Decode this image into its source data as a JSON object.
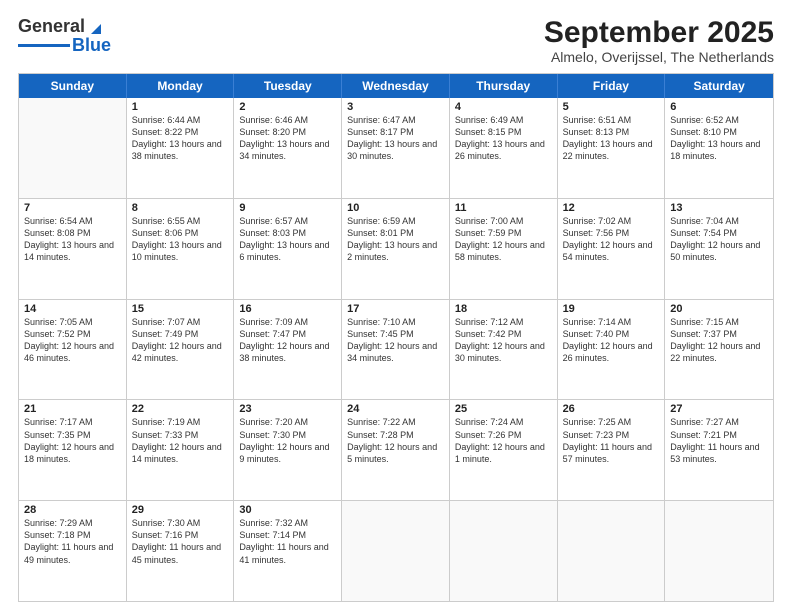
{
  "logo": {
    "line1": "General",
    "line2": "Blue"
  },
  "title": "September 2025",
  "location": "Almelo, Overijssel, The Netherlands",
  "header_days": [
    "Sunday",
    "Monday",
    "Tuesday",
    "Wednesday",
    "Thursday",
    "Friday",
    "Saturday"
  ],
  "rows": [
    [
      {
        "day": "",
        "sunrise": "",
        "sunset": "",
        "daylight": ""
      },
      {
        "day": "1",
        "sunrise": "Sunrise: 6:44 AM",
        "sunset": "Sunset: 8:22 PM",
        "daylight": "Daylight: 13 hours and 38 minutes."
      },
      {
        "day": "2",
        "sunrise": "Sunrise: 6:46 AM",
        "sunset": "Sunset: 8:20 PM",
        "daylight": "Daylight: 13 hours and 34 minutes."
      },
      {
        "day": "3",
        "sunrise": "Sunrise: 6:47 AM",
        "sunset": "Sunset: 8:17 PM",
        "daylight": "Daylight: 13 hours and 30 minutes."
      },
      {
        "day": "4",
        "sunrise": "Sunrise: 6:49 AM",
        "sunset": "Sunset: 8:15 PM",
        "daylight": "Daylight: 13 hours and 26 minutes."
      },
      {
        "day": "5",
        "sunrise": "Sunrise: 6:51 AM",
        "sunset": "Sunset: 8:13 PM",
        "daylight": "Daylight: 13 hours and 22 minutes."
      },
      {
        "day": "6",
        "sunrise": "Sunrise: 6:52 AM",
        "sunset": "Sunset: 8:10 PM",
        "daylight": "Daylight: 13 hours and 18 minutes."
      }
    ],
    [
      {
        "day": "7",
        "sunrise": "Sunrise: 6:54 AM",
        "sunset": "Sunset: 8:08 PM",
        "daylight": "Daylight: 13 hours and 14 minutes."
      },
      {
        "day": "8",
        "sunrise": "Sunrise: 6:55 AM",
        "sunset": "Sunset: 8:06 PM",
        "daylight": "Daylight: 13 hours and 10 minutes."
      },
      {
        "day": "9",
        "sunrise": "Sunrise: 6:57 AM",
        "sunset": "Sunset: 8:03 PM",
        "daylight": "Daylight: 13 hours and 6 minutes."
      },
      {
        "day": "10",
        "sunrise": "Sunrise: 6:59 AM",
        "sunset": "Sunset: 8:01 PM",
        "daylight": "Daylight: 13 hours and 2 minutes."
      },
      {
        "day": "11",
        "sunrise": "Sunrise: 7:00 AM",
        "sunset": "Sunset: 7:59 PM",
        "daylight": "Daylight: 12 hours and 58 minutes."
      },
      {
        "day": "12",
        "sunrise": "Sunrise: 7:02 AM",
        "sunset": "Sunset: 7:56 PM",
        "daylight": "Daylight: 12 hours and 54 minutes."
      },
      {
        "day": "13",
        "sunrise": "Sunrise: 7:04 AM",
        "sunset": "Sunset: 7:54 PM",
        "daylight": "Daylight: 12 hours and 50 minutes."
      }
    ],
    [
      {
        "day": "14",
        "sunrise": "Sunrise: 7:05 AM",
        "sunset": "Sunset: 7:52 PM",
        "daylight": "Daylight: 12 hours and 46 minutes."
      },
      {
        "day": "15",
        "sunrise": "Sunrise: 7:07 AM",
        "sunset": "Sunset: 7:49 PM",
        "daylight": "Daylight: 12 hours and 42 minutes."
      },
      {
        "day": "16",
        "sunrise": "Sunrise: 7:09 AM",
        "sunset": "Sunset: 7:47 PM",
        "daylight": "Daylight: 12 hours and 38 minutes."
      },
      {
        "day": "17",
        "sunrise": "Sunrise: 7:10 AM",
        "sunset": "Sunset: 7:45 PM",
        "daylight": "Daylight: 12 hours and 34 minutes."
      },
      {
        "day": "18",
        "sunrise": "Sunrise: 7:12 AM",
        "sunset": "Sunset: 7:42 PM",
        "daylight": "Daylight: 12 hours and 30 minutes."
      },
      {
        "day": "19",
        "sunrise": "Sunrise: 7:14 AM",
        "sunset": "Sunset: 7:40 PM",
        "daylight": "Daylight: 12 hours and 26 minutes."
      },
      {
        "day": "20",
        "sunrise": "Sunrise: 7:15 AM",
        "sunset": "Sunset: 7:37 PM",
        "daylight": "Daylight: 12 hours and 22 minutes."
      }
    ],
    [
      {
        "day": "21",
        "sunrise": "Sunrise: 7:17 AM",
        "sunset": "Sunset: 7:35 PM",
        "daylight": "Daylight: 12 hours and 18 minutes."
      },
      {
        "day": "22",
        "sunrise": "Sunrise: 7:19 AM",
        "sunset": "Sunset: 7:33 PM",
        "daylight": "Daylight: 12 hours and 14 minutes."
      },
      {
        "day": "23",
        "sunrise": "Sunrise: 7:20 AM",
        "sunset": "Sunset: 7:30 PM",
        "daylight": "Daylight: 12 hours and 9 minutes."
      },
      {
        "day": "24",
        "sunrise": "Sunrise: 7:22 AM",
        "sunset": "Sunset: 7:28 PM",
        "daylight": "Daylight: 12 hours and 5 minutes."
      },
      {
        "day": "25",
        "sunrise": "Sunrise: 7:24 AM",
        "sunset": "Sunset: 7:26 PM",
        "daylight": "Daylight: 12 hours and 1 minute."
      },
      {
        "day": "26",
        "sunrise": "Sunrise: 7:25 AM",
        "sunset": "Sunset: 7:23 PM",
        "daylight": "Daylight: 11 hours and 57 minutes."
      },
      {
        "day": "27",
        "sunrise": "Sunrise: 7:27 AM",
        "sunset": "Sunset: 7:21 PM",
        "daylight": "Daylight: 11 hours and 53 minutes."
      }
    ],
    [
      {
        "day": "28",
        "sunrise": "Sunrise: 7:29 AM",
        "sunset": "Sunset: 7:18 PM",
        "daylight": "Daylight: 11 hours and 49 minutes."
      },
      {
        "day": "29",
        "sunrise": "Sunrise: 7:30 AM",
        "sunset": "Sunset: 7:16 PM",
        "daylight": "Daylight: 11 hours and 45 minutes."
      },
      {
        "day": "30",
        "sunrise": "Sunrise: 7:32 AM",
        "sunset": "Sunset: 7:14 PM",
        "daylight": "Daylight: 11 hours and 41 minutes."
      },
      {
        "day": "",
        "sunrise": "",
        "sunset": "",
        "daylight": ""
      },
      {
        "day": "",
        "sunrise": "",
        "sunset": "",
        "daylight": ""
      },
      {
        "day": "",
        "sunrise": "",
        "sunset": "",
        "daylight": ""
      },
      {
        "day": "",
        "sunrise": "",
        "sunset": "",
        "daylight": ""
      }
    ]
  ]
}
